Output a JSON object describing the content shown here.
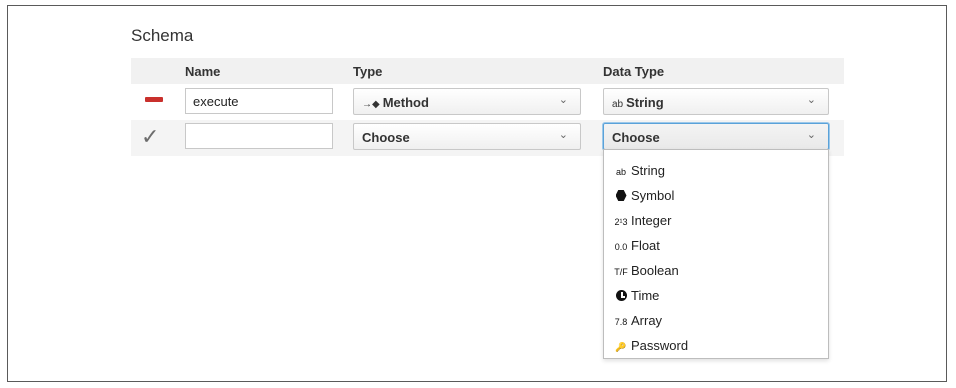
{
  "schema": {
    "title": "Schema",
    "columns": {
      "name": "Name",
      "type": "Type",
      "data_type": "Data Type"
    },
    "rows": [
      {
        "action_icon": "minus-icon",
        "name_value": "execute",
        "type_icon_text": "→◆",
        "type_value": "Method",
        "data_type_icon_text": "ab",
        "data_type_value": "String"
      },
      {
        "action_icon": "checkmark-icon",
        "action_glyph": "✓",
        "name_value": "",
        "type_value": "Choose",
        "data_type_value": "Choose"
      }
    ],
    "chevron": "⌄"
  },
  "dropdown": {
    "options": [
      {
        "icon": "ab",
        "icon_name": "string-icon",
        "label": "String"
      },
      {
        "icon": "",
        "icon_name": "symbol-icon",
        "label": "Symbol"
      },
      {
        "icon": "2¹3",
        "icon_name": "integer-icon",
        "label": "Integer"
      },
      {
        "icon": "0.0",
        "icon_name": "float-icon",
        "label": "Float"
      },
      {
        "icon": "T/F",
        "icon_name": "boolean-icon",
        "label": "Boolean"
      },
      {
        "icon": "",
        "icon_name": "clock-icon",
        "label": "Time"
      },
      {
        "icon": "7.8",
        "icon_name": "array-icon",
        "label": "Array"
      },
      {
        "icon": "🔑",
        "icon_name": "key-icon",
        "label": "Password"
      }
    ]
  },
  "colors": {
    "remove": "#c9302c",
    "focus": "#5aa2d9",
    "header_bg": "#f1f1f1"
  }
}
